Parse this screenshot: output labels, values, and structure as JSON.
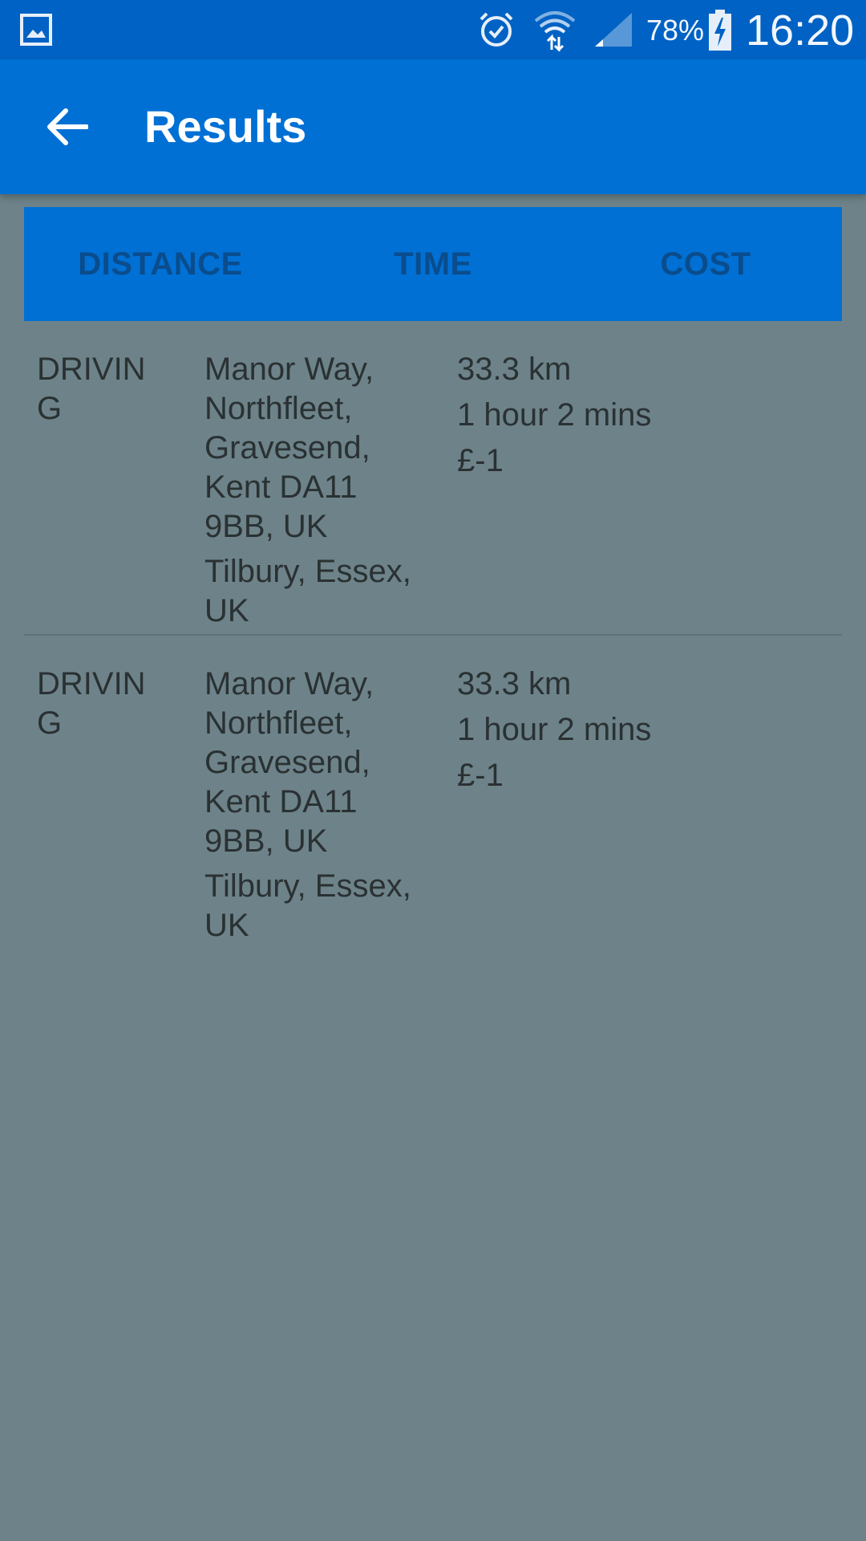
{
  "status_bar": {
    "battery_percent": "78%",
    "clock": "16:20",
    "icons": [
      "gallery-icon",
      "alarm-icon",
      "wifi-icon",
      "signal-icon",
      "battery-charging-icon"
    ]
  },
  "app_bar": {
    "title": "Results",
    "back_icon": "back-arrow-icon"
  },
  "sort_tabs": [
    {
      "label": "DISTANCE"
    },
    {
      "label": "TIME"
    },
    {
      "label": "COST"
    }
  ],
  "results": [
    {
      "mode": "DRIVING",
      "origin": "Manor Way, Northfleet, Gravesend, Kent DA11 9BB, UK",
      "destination": "Tilbury, Essex, UK",
      "distance": "33.3 km",
      "duration": "1 hour 2 mins",
      "cost": "£-1"
    },
    {
      "mode": "DRIVING",
      "origin": "Manor Way, Northfleet, Gravesend, Kent DA11 9BB, UK",
      "destination": "Tilbury, Essex, UK",
      "distance": "33.3 km",
      "duration": "1 hour 2 mins",
      "cost": "£-1"
    }
  ],
  "colors": {
    "status_bar": "#0062c4",
    "app_bar": "#0070d4",
    "background": "#6d8389",
    "tab_text": "#0a4c8c",
    "row_text": "#2a3133"
  }
}
